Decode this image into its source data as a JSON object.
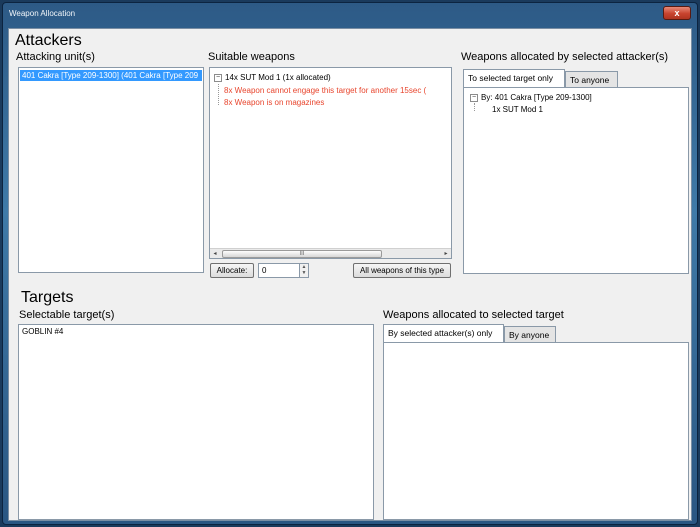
{
  "window": {
    "title": "Weapon Allocation",
    "close_label": "x"
  },
  "attackers": {
    "section_title": "Attackers",
    "attacking_units_label": "Attacking unit(s)",
    "attacking_units": [
      "401 Cakra [Type 209-1300] (401 Cakra [Type 209"
    ],
    "suitable_weapons_label": "Suitable weapons",
    "weapon_tree": {
      "root": "14x SUT Mod 1 (1x allocated)",
      "root_toggle": "−",
      "children": [
        "8x Weapon cannot engage this target for another 15sec (",
        "8x Weapon is on magazines"
      ]
    },
    "allocate_button": "Allocate:",
    "allocate_value": "0",
    "all_weapons_button": "All weapons of this type",
    "scroll_left": "◂",
    "scroll_right": "▸",
    "scroll_grip": "III",
    "allocated_by_attacker_label": "Weapons allocated by selected attacker(s)",
    "tabs": [
      "To selected target only",
      "To anyone"
    ],
    "allocated_tree": {
      "root": "By: 401 Cakra [Type 209-1300]",
      "root_toggle": "−",
      "children": [
        "1x SUT Mod 1"
      ]
    }
  },
  "targets": {
    "section_title": "Targets",
    "selectable_targets_label": "Selectable target(s)",
    "selectable_targets": [
      "GOBLIN #4"
    ],
    "allocated_to_target_label": "Weapons allocated to selected target",
    "tabs": [
      "By selected attacker(s) only",
      "By anyone"
    ]
  }
}
